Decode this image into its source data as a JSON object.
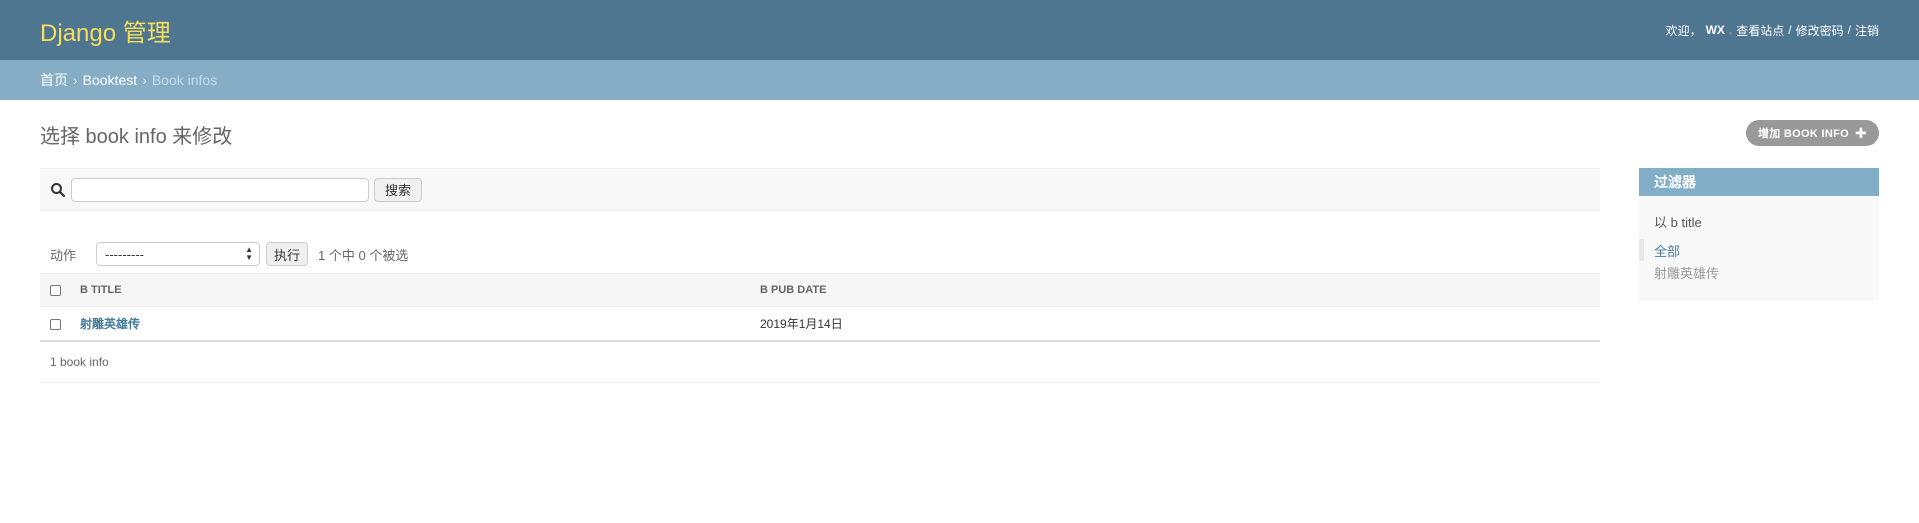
{
  "header": {
    "brand": "Django 管理",
    "welcome": "欢迎，",
    "username": "WX",
    "dot": ".",
    "view_site": "查看站点",
    "sep1": "/",
    "change_password": "修改密码",
    "sep2": "/",
    "logout": "注销"
  },
  "breadcrumbs": {
    "home": "首页",
    "sep1": "›",
    "app": "Booktest",
    "sep2": "›",
    "current": "Book infos"
  },
  "main": {
    "title": "选择 book info 来修改",
    "add_button": "增加 BOOK INFO",
    "add_icon": "plus-icon"
  },
  "search": {
    "icon": "search-icon",
    "value": "",
    "button": "搜索"
  },
  "actions": {
    "label": "动作",
    "selected_option": "---------",
    "go_button": "执行",
    "counter": "1 个中 0 个被选"
  },
  "table": {
    "columns": [
      "B TITLE",
      "B PUB DATE"
    ],
    "rows": [
      {
        "b_title": "射雕英雄传",
        "b_pub_date": "2019年1月14日"
      }
    ]
  },
  "paginator": "1 book info",
  "filter": {
    "title": "过滤器",
    "subtitle": "以 b title",
    "options": [
      "全部",
      "射雕英雄传"
    ],
    "selected_index": 0
  },
  "colors": {
    "header_bg": "#4e7690",
    "brand": "#f5dd5d",
    "breadcrumbs_bg": "#85adc5",
    "link": "#447e9b",
    "filter_header_bg": "#83aec7"
  }
}
